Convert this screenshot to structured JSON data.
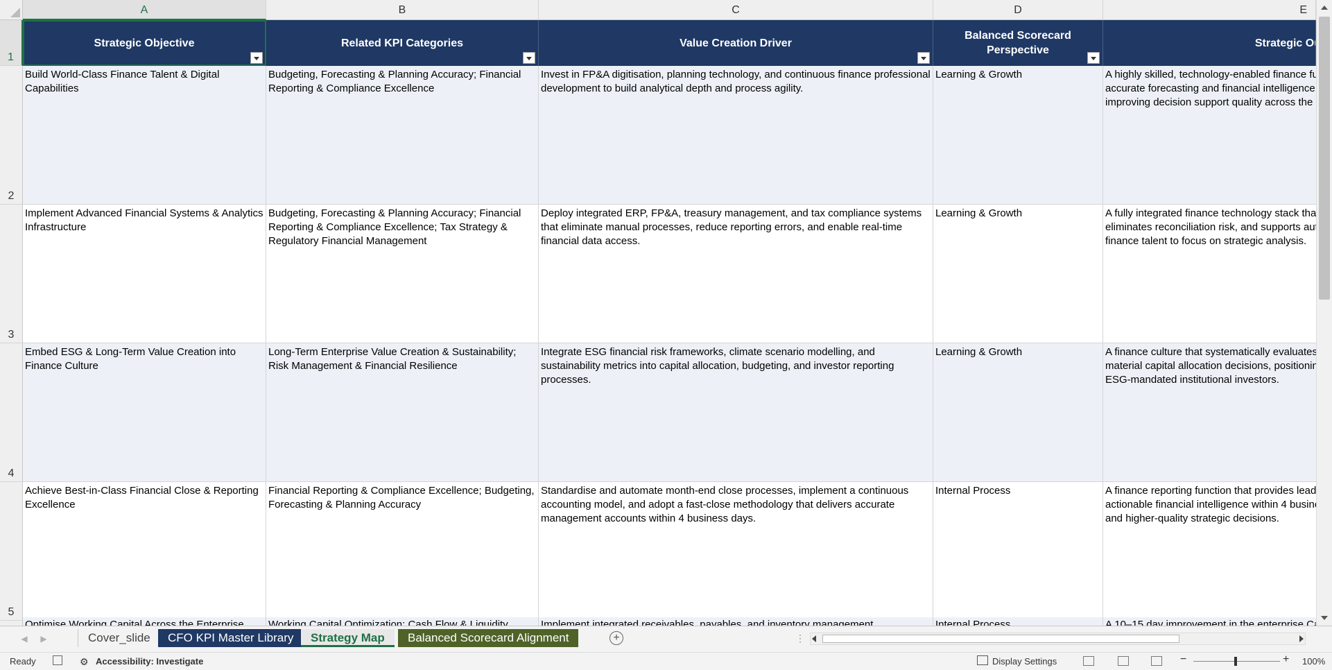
{
  "columns": [
    "A",
    "B",
    "C",
    "D",
    "E"
  ],
  "row_numbers": [
    "1",
    "2",
    "3",
    "4",
    "5"
  ],
  "headers": [
    "Strategic Objective",
    "Related KPI Categories",
    "Value Creation Driver",
    "Balanced Scorecard Perspective",
    "Strategic Ou"
  ],
  "rows": [
    {
      "objective": "Build World-Class Finance Talent & Digital Capabilities",
      "kpi": "Budgeting, Forecasting & Planning Accuracy; Financial Reporting & Compliance Excellence",
      "driver": "Invest in FP&A digitisation, planning technology, and continuous finance professional development to build analytical depth and process agility.",
      "perspective": "Learning & Growth",
      "outcome": "A highly skilled, technology-enabled finance fun accurate forecasting and financial intelligence, improving decision support quality across the c"
    },
    {
      "objective": "Implement Advanced Financial Systems & Analytics Infrastructure",
      "kpi": "Budgeting, Forecasting & Planning Accuracy; Financial Reporting & Compliance Excellence; Tax Strategy & Regulatory Financial Management",
      "driver": "Deploy integrated ERP, FP&A, treasury management, and tax compliance systems that eliminate manual processes, reduce reporting errors, and enable real-time financial data access.",
      "perspective": "Learning & Growth",
      "outcome": "A fully integrated finance technology stack that eliminates reconciliation risk, and supports aut finance talent to focus on strategic analysis."
    },
    {
      "objective": "Embed ESG & Long-Term Value Creation into Finance Culture",
      "kpi": "Long-Term Enterprise Value Creation & Sustainability; Risk Management & Financial Resilience",
      "driver": "Integrate ESG financial risk frameworks, climate scenario modelling, and sustainability metrics into capital allocation, budgeting, and investor reporting processes.",
      "perspective": "Learning & Growth",
      "outcome": "A finance culture that systematically evaluates material capital allocation decisions, positioning ESG-mandated institutional investors."
    },
    {
      "objective": "Achieve Best-in-Class Financial Close & Reporting Excellence",
      "kpi": "Financial Reporting & Compliance Excellence; Budgeting, Forecasting & Planning Accuracy",
      "driver": "Standardise and automate month-end close processes, implement a continuous accounting model, and adopt a fast-close methodology that delivers accurate management accounts within 4 business days.",
      "perspective": "Internal Process",
      "outcome": "A finance reporting function that provides leade actionable financial intelligence within 4 busine and higher-quality strategic decisions."
    }
  ],
  "partial_row": {
    "objective": "Optimise Working Capital Across the Enterprise",
    "kpi": "Working Capital Optimization; Cash Flow & Liquidity",
    "driver": "Implement integrated receivables, payables, and inventory management",
    "perspective": "Internal Process",
    "outcome": "A 10–15 day improvement in the enterprise Ca"
  },
  "tabs": {
    "cover": "Cover_slide",
    "master": "CFO KPI Master Library",
    "strategy": "Strategy Map",
    "balanced": "Balanced Scorecard Alignment"
  },
  "status": {
    "ready": "Ready",
    "accessibility": "Accessibility: Investigate",
    "display_settings": "Display Settings",
    "zoom": "100%"
  },
  "colors": {
    "header_fill": "#1f3864",
    "band_fill": "#edf1f7",
    "active_tab_text": "#1f7145",
    "tab_navy": "#1f3864",
    "tab_olive": "#4f6228"
  }
}
